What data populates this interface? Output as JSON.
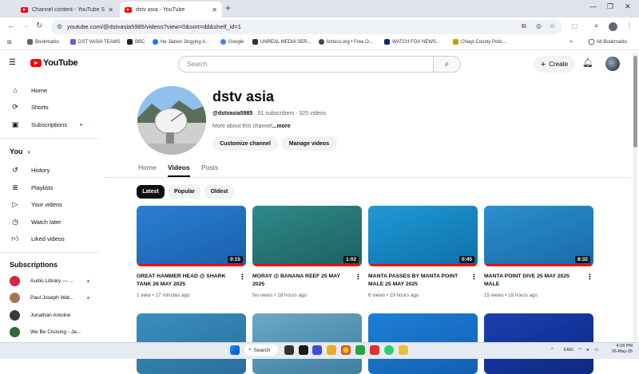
{
  "browser": {
    "tabs": [
      {
        "title": "Channel content - YouTube Stu",
        "active": false
      },
      {
        "title": "dstv asia - YouTube",
        "active": true
      }
    ],
    "url": "youtube.com/@dstvasia5985/videos?view=0&sort=dd&shelf_id=1",
    "bookmarks": [
      {
        "label": "Bookmarks",
        "icon": "star-icon",
        "color": "#555555"
      },
      {
        "label": "DST VASIA TEAMS",
        "icon": "teams-icon",
        "color": "#5b5fc7"
      },
      {
        "label": "BBC",
        "icon": "bbc-icon",
        "color": "#222222"
      },
      {
        "label": "He Jianen Jingying A...",
        "icon": "facebook-icon",
        "color": "#1877f2"
      },
      {
        "label": "Google",
        "icon": "google-icon",
        "color": "#4285f4"
      },
      {
        "label": "UNREAL MEDIA SER...",
        "icon": "unreal-icon",
        "color": "#333333"
      },
      {
        "label": "lichess.org • Free O...",
        "icon": "lichess-icon",
        "color": "#444444"
      },
      {
        "label": "WATCH FOX NEWS...",
        "icon": "fox-icon",
        "color": "#0a2a66"
      },
      {
        "label": "Chiayi County Polic...",
        "icon": "police-icon",
        "color": "#c8a000"
      }
    ],
    "all_bookmarks": "All Bookmarks"
  },
  "youtube": {
    "logo_text": "YouTube",
    "search_placeholder": "Search",
    "create_label": "Create"
  },
  "sidebar": {
    "main": [
      {
        "label": "Home",
        "icon": "home-icon"
      },
      {
        "label": "Shorts",
        "icon": "shorts-icon"
      },
      {
        "label": "Subscriptions",
        "icon": "subscriptions-icon",
        "dot": true
      }
    ],
    "you_heading": "You",
    "you_items": [
      {
        "label": "History",
        "icon": "history-icon"
      },
      {
        "label": "Playlists",
        "icon": "playlists-icon"
      },
      {
        "label": "Your videos",
        "icon": "your-videos-icon"
      },
      {
        "label": "Watch later",
        "icon": "watch-later-icon"
      },
      {
        "label": "Liked videos",
        "icon": "liked-videos-icon"
      }
    ],
    "subs_heading": "Subscriptions",
    "subscriptions": [
      {
        "label": "Audio Library — ...",
        "color": "#d9233f",
        "dot": true
      },
      {
        "label": "Paul Joseph Wat...",
        "color": "#a0785a",
        "dot": true
      },
      {
        "label": "Jonathan Antoine",
        "color": "#3a3a3a",
        "dot": false
      },
      {
        "label": "We Be Cruising - Ja...",
        "color": "#2f6b3a",
        "dot": false
      }
    ]
  },
  "channel": {
    "name": "dstv asia",
    "handle": "@dstvasia5985",
    "stats": "· 91 subscribers · 325 videos",
    "about": "More about this channel",
    "more": "...more",
    "customize_label": "Customize channel",
    "manage_label": "Manage videos",
    "tabs": [
      "Home",
      "Videos",
      "Posts"
    ],
    "selected_tab": "Videos",
    "sort_chips": [
      "Latest",
      "Popular",
      "Oldest"
    ],
    "selected_chip": "Latest"
  },
  "videos": [
    {
      "title": "GREAT HAMMER HEAD @ SHARK TANK 26 MAY 2025",
      "views": "1 view",
      "age": "17 minutes ago",
      "duration": "0:15",
      "progress": 1.0,
      "thumb": [
        "#2a7fd1",
        "#1b5fae"
      ]
    },
    {
      "title": "MORAY @ BANANA REEF 25 MAY 2025",
      "views": "No views",
      "age": "18 hours ago",
      "duration": "1:02",
      "progress": 1.0,
      "thumb": [
        "#2f8a8a",
        "#1f5f60"
      ]
    },
    {
      "title": "MANTA PASSES BY MANTA POINT MALE 25 MAY 2025",
      "views": "6 views",
      "age": "19 hours ago",
      "duration": "0:45",
      "progress": 1.0,
      "thumb": [
        "#1e9ad6",
        "#0f6fa8"
      ]
    },
    {
      "title": "MANTA POINT DIVE 25 MAY 2025 MALE",
      "views": "15 views",
      "age": "19 hours ago",
      "duration": "8:32",
      "progress": 1.0,
      "thumb": [
        "#2a8fd0",
        "#196aa6"
      ]
    },
    {
      "title": "",
      "views": "",
      "age": "",
      "duration": "",
      "progress": 0,
      "thumb": [
        "#3a8fbf",
        "#2a6f9a"
      ]
    },
    {
      "title": "",
      "views": "",
      "age": "",
      "duration": "",
      "progress": 0,
      "thumb": [
        "#6aa9c8",
        "#3f7f9f"
      ]
    },
    {
      "title": "",
      "views": "",
      "age": "",
      "duration": "",
      "progress": 0,
      "thumb": [
        "#1d7fd8",
        "#1360b0"
      ]
    },
    {
      "title": "",
      "views": "",
      "age": "",
      "duration": "",
      "progress": 0,
      "thumb": [
        "#1a3fb0",
        "#0d2a80"
      ]
    }
  ],
  "taskbar": {
    "search_label": "Search",
    "lang": "ENG",
    "time": "4:18 PM",
    "date": "26-May-25"
  }
}
